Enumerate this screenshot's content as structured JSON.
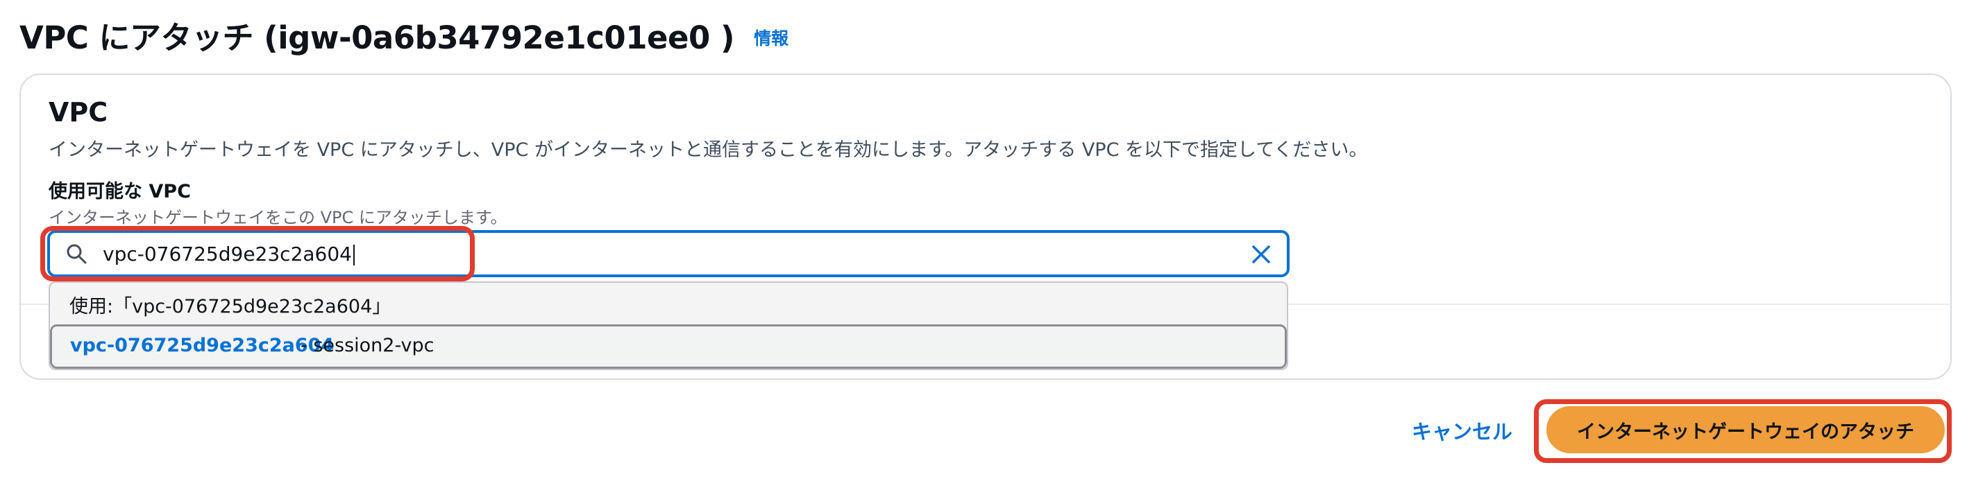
{
  "header": {
    "title": "VPC にアタッチ (igw-0a6b34792e1c01ee0 )",
    "info_link": "情報"
  },
  "vpc_section": {
    "title": "VPC",
    "description": "インターネットゲートウェイを VPC にアタッチし、VPC がインターネットと通信することを有効にします。アタッチする VPC を以下で指定してください。",
    "field_label": "使用可能な VPC",
    "field_description": "インターネットゲートウェイをこの VPC にアタッチします。",
    "search": {
      "value": "vpc-076725d9e23c2a604"
    },
    "dropdown": {
      "use_option": "使用:「vpc-076725d9e23c2a604」",
      "options": [
        {
          "vpc_id": "vpc-076725d9e23c2a604",
          "vpc_name": "- session2-vpc"
        }
      ]
    }
  },
  "footer": {
    "cancel_label": "キャンセル",
    "submit_label": "インターネットゲートウェイのアタッチ"
  },
  "colors": {
    "accent_link": "#0972d3",
    "primary_button": "#f09d3c",
    "highlight": "#e03c2d"
  },
  "icons": {
    "search": "search-icon",
    "clear": "close-icon"
  }
}
